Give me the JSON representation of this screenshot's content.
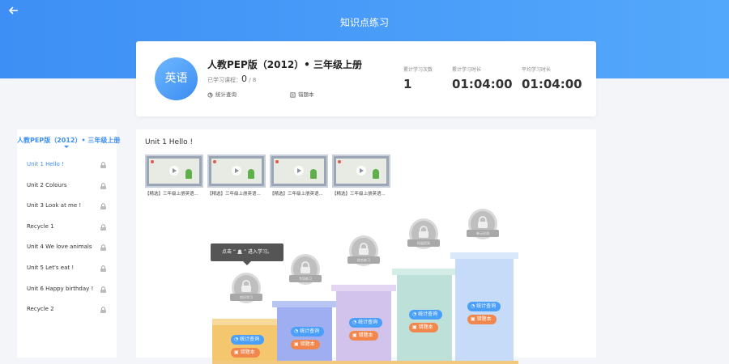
{
  "header": {
    "title": "知识点练习",
    "back_icon": "arrow-left-icon"
  },
  "course": {
    "avatar_text": "英语",
    "title": "人教PEP版（2012）• 三年级上册",
    "lessons_label": "已学习课程：",
    "lessons_done": "0",
    "lessons_total": "/ 8",
    "stats_link": "统计查询",
    "mistakes_link": "错题本",
    "stats": [
      {
        "label": "累计学习次数",
        "value": "1"
      },
      {
        "label": "累计学习时长",
        "value": "01:04:00"
      },
      {
        "label": "平均学习时长",
        "value": "01:04:00"
      }
    ]
  },
  "sidebar": {
    "title": "人教PEP版（2012）• 三年级上册",
    "items": [
      {
        "label": "Unit 1 Hello !",
        "active": true
      },
      {
        "label": "Unit 2 Colours"
      },
      {
        "label": "Unit 3 Look at me !"
      },
      {
        "label": "Recycle 1"
      },
      {
        "label": "Unit 4 We love animals"
      },
      {
        "label": "Unit 5 Let's eat !"
      },
      {
        "label": "Unit 6 Happy birthday !"
      },
      {
        "label": "Recycle 2"
      }
    ]
  },
  "main": {
    "unit_title": "Unit 1 Hello !",
    "videos": [
      {
        "caption": "【精选】三年级上册英语..."
      },
      {
        "caption": "【精选】三年级上册英语..."
      },
      {
        "caption": "【精选】三年级上册英语..."
      },
      {
        "caption": "【精选】三年级上册英语..."
      }
    ],
    "tooltip_prefix": "点击",
    "tooltip_suffix": "进入学习。",
    "badges": [
      {
        "label": "知识学习"
      },
      {
        "label": "专项练习"
      },
      {
        "label": "综合练习"
      },
      {
        "label": "拓展提高"
      },
      {
        "label": "单元检测"
      }
    ],
    "stats_btn": "统计查询",
    "mistakes_btn": "错题本"
  },
  "colors": {
    "primary": "#3d8ff5",
    "orange": "#f1874c"
  }
}
